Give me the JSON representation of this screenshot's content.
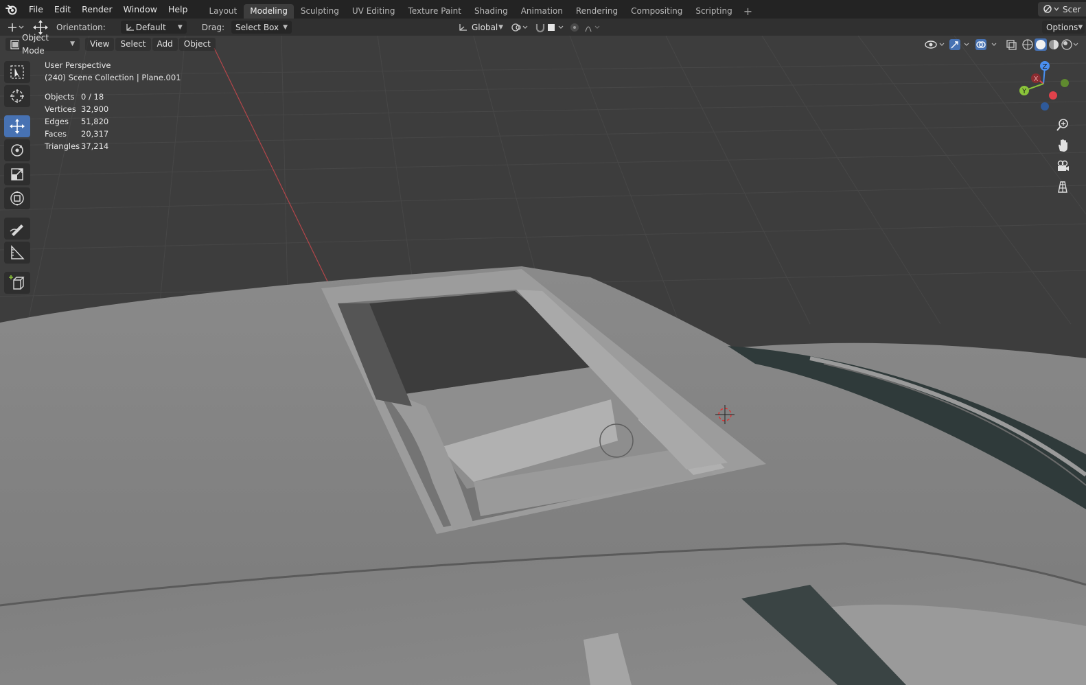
{
  "menu": {
    "items": [
      "File",
      "Edit",
      "Render",
      "Window",
      "Help"
    ]
  },
  "workspaces": {
    "tabs": [
      "Layout",
      "Modeling",
      "Sculpting",
      "UV Editing",
      "Texture Paint",
      "Shading",
      "Animation",
      "Rendering",
      "Compositing",
      "Scripting"
    ],
    "active": "Modeling",
    "add_label": "+"
  },
  "scene": {
    "label": "Scer"
  },
  "tool_settings": {
    "orientation_label": "Orientation:",
    "orientation_value": "Default",
    "drag_label": "Drag:",
    "drag_value": "Select Box",
    "transform_space": "Global",
    "options_label": "Options"
  },
  "viewport_header": {
    "mode": "Object Mode",
    "view": "View",
    "select": "Select",
    "add": "Add",
    "object": "Object"
  },
  "overlay": {
    "perspective": "User Perspective",
    "collection": "(240) Scene Collection | Plane.001",
    "stats": [
      {
        "key": "Objects",
        "value": "0 / 18"
      },
      {
        "key": "Vertices",
        "value": "32,900"
      },
      {
        "key": "Edges",
        "value": "51,820"
      },
      {
        "key": "Faces",
        "value": "20,317"
      },
      {
        "key": "Triangles",
        "value": "37,214"
      }
    ]
  },
  "gizmo": {
    "x": "X",
    "y": "Y",
    "z": "Z"
  },
  "tools": [
    "select-box-icon",
    "cursor-icon",
    "move-icon",
    "rotate-icon",
    "scale-icon",
    "transform-icon",
    "annotate-icon",
    "measure-icon",
    "add-cube-icon"
  ],
  "colors": {
    "accent": "#4772b3",
    "axis_x": "#e0424b",
    "axis_y": "#8bc43a",
    "axis_z": "#4a8ff0"
  }
}
